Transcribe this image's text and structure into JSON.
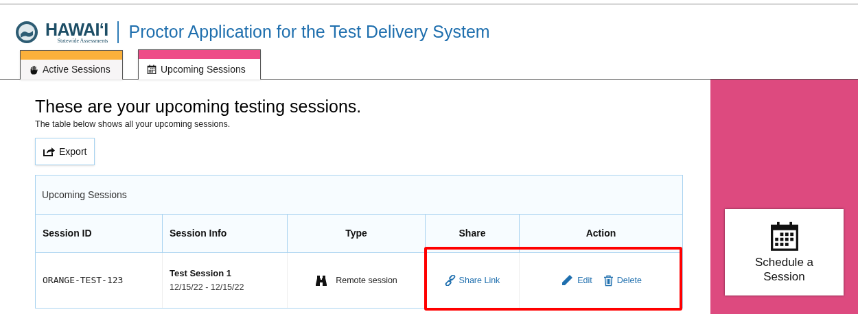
{
  "header": {
    "logo_name": "HAWAI‘I",
    "logo_tagline": "Statewide Assessments",
    "title": "Proctor Application for the Test Delivery System"
  },
  "tabs": [
    {
      "label": "Active Sessions",
      "kind": "hand",
      "color": "#fbb03b",
      "selected": false
    },
    {
      "label": "Upcoming Sessions",
      "kind": "calendar",
      "color": "#ee4d88",
      "selected": true
    }
  ],
  "page": {
    "heading": "These are your upcoming testing sessions.",
    "subheading": "The table below shows all your upcoming sessions.",
    "export_button": "Export"
  },
  "table": {
    "caption": "Upcoming Sessions",
    "columns": [
      "Session ID",
      "Session Info",
      "Type",
      "Share",
      "Action"
    ],
    "rows": [
      {
        "session_id": "ORANGE-TEST-123",
        "name": "Test Session 1",
        "dates": "12/15/22 - 12/15/22",
        "type": "Remote session",
        "share": "Share Link",
        "actions": [
          "Edit",
          "Delete"
        ],
        "highlighted": true
      }
    ]
  },
  "side_panel": {
    "button": "Schedule a Session"
  }
}
